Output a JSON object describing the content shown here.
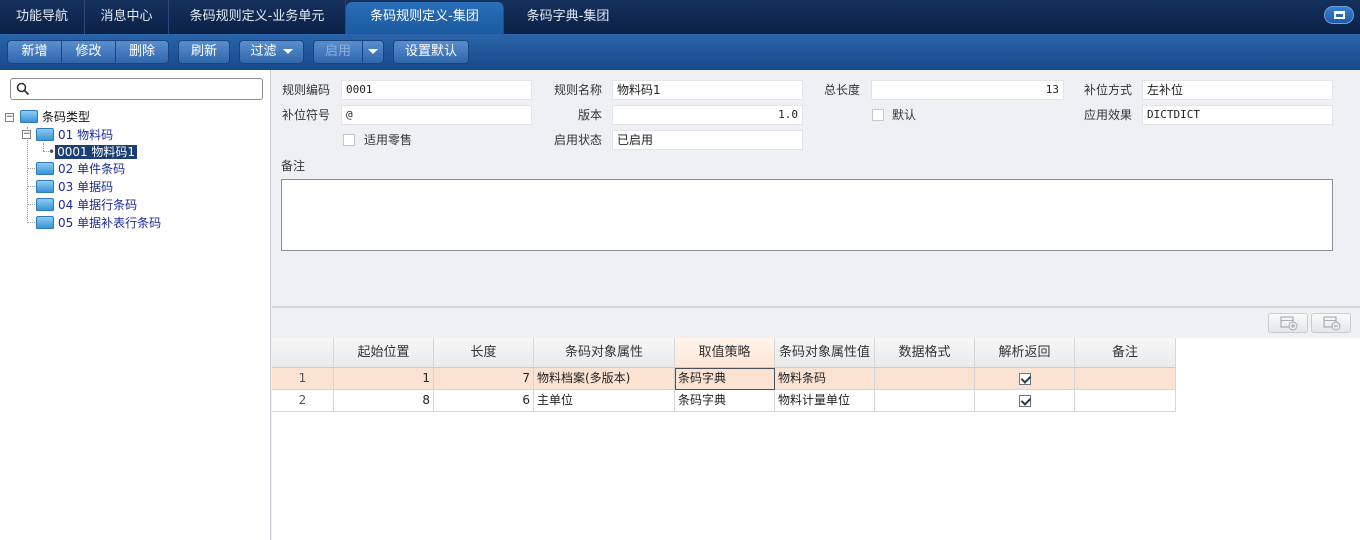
{
  "tabs": [
    {
      "label": "功能导航"
    },
    {
      "label": "消息中心"
    },
    {
      "label": "条码规则定义-业务单元"
    },
    {
      "label": "条码规则定义-集团"
    },
    {
      "label": "条码字典-集团"
    }
  ],
  "toolbar": {
    "new": "新增",
    "edit": "修改",
    "delete": "删除",
    "refresh": "刷新",
    "filter": "过滤",
    "enable": "启用",
    "set_default": "设置默认"
  },
  "tree": {
    "root": "条码类型",
    "nodes": [
      {
        "code": "01",
        "name": "物料码"
      },
      {
        "child": "0001 物料码1"
      },
      {
        "code": "02",
        "name": "单件条码"
      },
      {
        "code": "03",
        "name": "单据码"
      },
      {
        "code": "04",
        "name": "单据行条码"
      },
      {
        "code": "05",
        "name": "单据补表行条码"
      }
    ]
  },
  "form": {
    "rule_code_label": "规则编码",
    "rule_code": "0001",
    "rule_name_label": "规则名称",
    "rule_name": "物料码1",
    "total_length_label": "总长度",
    "total_length": "13",
    "pad_mode_label": "补位方式",
    "pad_mode": "左补位",
    "pad_char_label": "补位符号",
    "pad_char": "@",
    "version_label": "版本",
    "version": "1.0",
    "default_label": "默认",
    "effect_label": "应用效果",
    "effect": "DICTDICT",
    "retail_label": "适用零售",
    "status_label": "启用状态",
    "status": "已启用",
    "remark_label": "备注"
  },
  "grid": {
    "headers": [
      "起始位置",
      "长度",
      "条码对象属性",
      "取值策略",
      "条码对象属性值",
      "数据格式",
      "解析返回",
      "备注"
    ],
    "rows": [
      {
        "idx": "1",
        "start": "1",
        "length": "7",
        "attr": "物料档案(多版本)",
        "strategy": "条码字典",
        "attr_value": "物料条码",
        "format": "",
        "parse": true,
        "remark": ""
      },
      {
        "idx": "2",
        "start": "8",
        "length": "6",
        "attr": "主单位",
        "strategy": "条码字典",
        "attr_value": "物料计量单位",
        "format": "",
        "parse": true,
        "remark": ""
      }
    ]
  }
}
